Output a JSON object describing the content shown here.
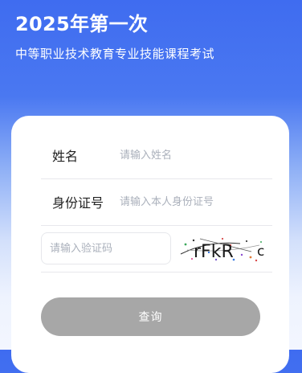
{
  "header": {
    "title": "2025年第一次",
    "subtitle": "中等职业技术教育专业技能课程考试"
  },
  "form": {
    "name_label": "姓名",
    "name_placeholder": "请输入姓名",
    "id_label": "身份证号",
    "id_placeholder": "请输入本人身份证号",
    "captcha_placeholder": "请输入验证码",
    "captcha_text": "rFkR",
    "captcha_extra": "c",
    "submit_label": "查询"
  },
  "colors": {
    "background_top": "#3f6cf0",
    "background_bottom": "#f3f6ff",
    "button": "#a7a7a7"
  }
}
